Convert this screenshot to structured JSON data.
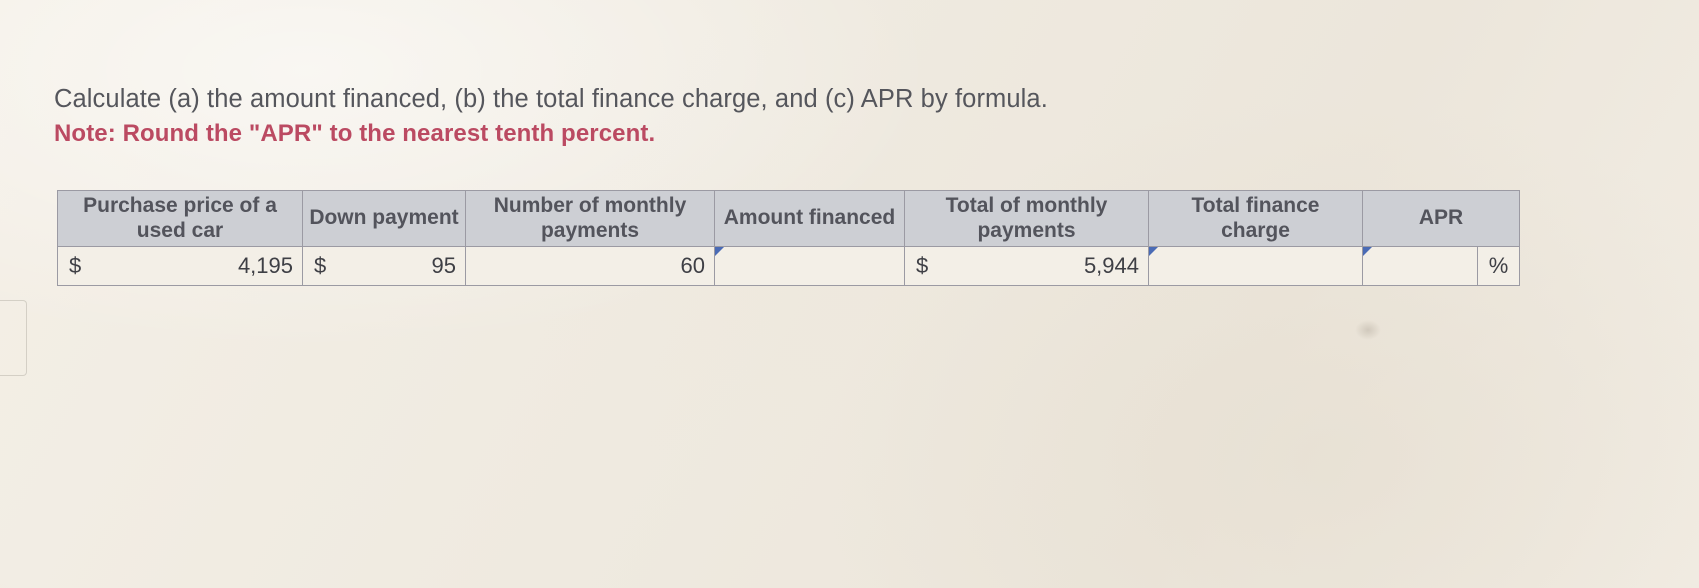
{
  "question": {
    "text": "Calculate (a) the amount financed, (b) the total finance charge, and (c) APR by formula.",
    "note": "Note: Round the \"APR\" to the nearest tenth percent."
  },
  "table": {
    "headers": [
      "Purchase price of a used car",
      "Down payment",
      "Number of monthly payments",
      "Amount financed",
      "Total of monthly payments",
      "Total finance charge",
      "APR"
    ],
    "row": {
      "purchase_price": {
        "currency": "$",
        "value": "4,195"
      },
      "down_payment": {
        "currency": "$",
        "value": "95"
      },
      "number_of_payments": {
        "value": "60"
      },
      "amount_financed": {
        "value": "",
        "placeholder": ""
      },
      "total_of_monthly_payments": {
        "currency": "$",
        "value": "5,944"
      },
      "total_finance_charge": {
        "value": "",
        "placeholder": ""
      },
      "apr": {
        "value": "",
        "placeholder": "",
        "suffix": "%"
      }
    }
  },
  "colors": {
    "page_background": "#f1ece3",
    "note_red": "#bb4a62",
    "question_gray": "#55565c",
    "header_fill": "#cdcfd4",
    "table_border": "#9b9aa3",
    "input_border": "#6d7fb3",
    "marker_blue": "#4a6bb5"
  }
}
